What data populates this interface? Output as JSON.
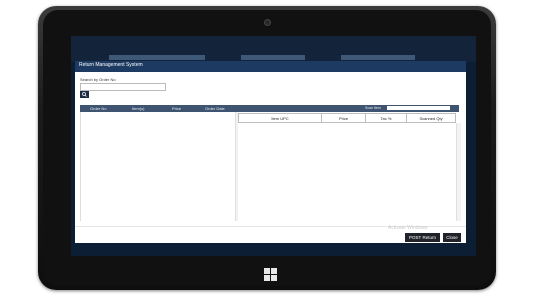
{
  "window": {
    "title": "Return Management System"
  },
  "search": {
    "label": "Search by Order No",
    "value": "",
    "button_icon": "search-icon"
  },
  "orders": {
    "columns": [
      "Order No",
      "Item(s)",
      "Price",
      "Order Date"
    ]
  },
  "scan": {
    "label": "Scan Item",
    "value": ""
  },
  "items": {
    "columns": [
      "Item UPC",
      "Price",
      "Tax %",
      "Scanned Qty"
    ]
  },
  "footer": {
    "watermark": "Activate Windows",
    "post_label": "POST Return",
    "close_label": "Close"
  },
  "colors": {
    "titlebar": "#1d3a63",
    "header": "#3e5470",
    "button": "#20232a"
  }
}
